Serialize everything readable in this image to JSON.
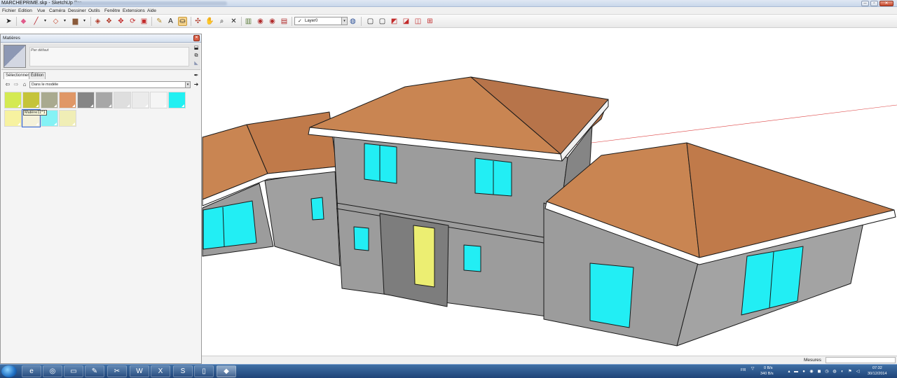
{
  "window": {
    "title": "MARCHEPRIME.skp - SketchUp Pro",
    "min_glyph": "─",
    "max_glyph": "▫",
    "close_glyph": "✕"
  },
  "menu": [
    "Fichier",
    "Edition",
    "Vue",
    "Caméra",
    "Dessiner",
    "Outils",
    "Fenêtre",
    "Extensions",
    "Aide"
  ],
  "toolbar": {
    "layer_check": "✓",
    "layer_name": "Layer0",
    "dropdown_glyph": "▾"
  },
  "materials_panel": {
    "title": "Matières",
    "close_glyph": "✕",
    "current_material": "Par défaut",
    "tabs": [
      "Sélectionner",
      "Édition"
    ],
    "library": "Dans le modèle",
    "tooltip": "Matière11^1",
    "swatches": [
      {
        "color": "#d4ea52"
      },
      {
        "color": "#c5c43a"
      },
      {
        "color": "#a9aa8f"
      },
      {
        "color": "#e09766"
      },
      {
        "color": "#858585"
      },
      {
        "color": "#a7a7a7"
      },
      {
        "color": "#dedede"
      },
      {
        "color": "#ebebeb"
      },
      {
        "color": "#f5f5f5"
      },
      {
        "color": "#22f0f2"
      },
      {
        "color": "#f7f2a0"
      },
      {
        "color": "#f5f2da"
      },
      {
        "color": "#84f2f5"
      },
      {
        "color": "#f0eeb6"
      }
    ]
  },
  "status": {
    "measurements_label": "Mesures",
    "measurements_value": ""
  },
  "colors": {
    "roof": "#c98552",
    "roof_shadow": "#9e5f3a",
    "wall": "#9c9c9c",
    "wall_dark": "#858585",
    "window": "#22eef4",
    "door": "#ecee72",
    "fascia": "#ffffff"
  },
  "taskbar": {
    "language": "FR",
    "network_up": "0 B/s",
    "network_down": "340 B/s",
    "time": "07:32",
    "date": "30/12/2014"
  }
}
